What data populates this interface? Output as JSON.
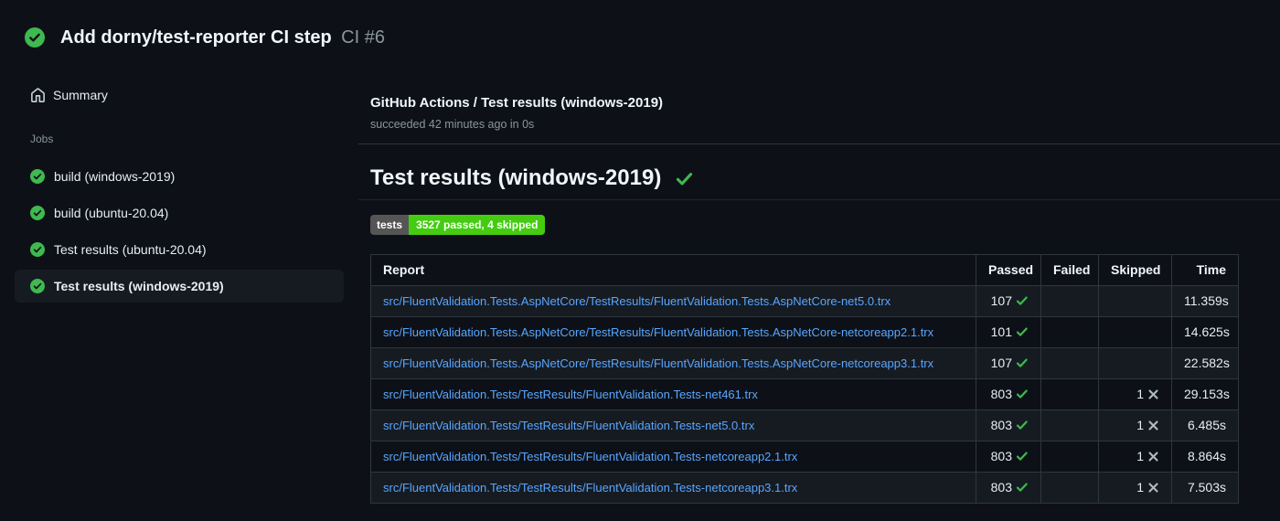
{
  "run_header": {
    "title": "Add dorny/test-reporter CI step",
    "run_number": "CI #6",
    "status": "success"
  },
  "sidebar": {
    "summary_label": "Summary",
    "jobs_label": "Jobs",
    "jobs": [
      {
        "label": "build (windows-2019)",
        "status": "success",
        "selected": false
      },
      {
        "label": "build (ubuntu-20.04)",
        "status": "success",
        "selected": false
      },
      {
        "label": "Test results (ubuntu-20.04)",
        "status": "success",
        "selected": false
      },
      {
        "label": "Test results (windows-2019)",
        "status": "success",
        "selected": true
      }
    ]
  },
  "check_header": {
    "title": "GitHub Actions / Test results (windows-2019)",
    "status_line": "succeeded 42 minutes ago in 0s"
  },
  "report": {
    "heading": "Test results (windows-2019)",
    "badge": {
      "label": "tests",
      "value": "3527 passed, 4 skipped"
    },
    "table": {
      "headers": [
        "Report",
        "Passed",
        "Failed",
        "Skipped",
        "Time"
      ],
      "rows": [
        {
          "report": "src/FluentValidation.Tests.AspNetCore/TestResults/FluentValidation.Tests.AspNetCore-net5.0.trx",
          "passed": "107",
          "failed": "",
          "skipped": "",
          "time": "11.359s"
        },
        {
          "report": "src/FluentValidation.Tests.AspNetCore/TestResults/FluentValidation.Tests.AspNetCore-netcoreapp2.1.trx",
          "passed": "101",
          "failed": "",
          "skipped": "",
          "time": "14.625s"
        },
        {
          "report": "src/FluentValidation.Tests.AspNetCore/TestResults/FluentValidation.Tests.AspNetCore-netcoreapp3.1.trx",
          "passed": "107",
          "failed": "",
          "skipped": "",
          "time": "22.582s"
        },
        {
          "report": "src/FluentValidation.Tests/TestResults/FluentValidation.Tests-net461.trx",
          "passed": "803",
          "failed": "",
          "skipped": "1",
          "time": "29.153s"
        },
        {
          "report": "src/FluentValidation.Tests/TestResults/FluentValidation.Tests-net5.0.trx",
          "passed": "803",
          "failed": "",
          "skipped": "1",
          "time": "6.485s"
        },
        {
          "report": "src/FluentValidation.Tests/TestResults/FluentValidation.Tests-netcoreapp2.1.trx",
          "passed": "803",
          "failed": "",
          "skipped": "1",
          "time": "8.864s"
        },
        {
          "report": "src/FluentValidation.Tests/TestResults/FluentValidation.Tests-netcoreapp3.1.trx",
          "passed": "803",
          "failed": "",
          "skipped": "1",
          "time": "7.503s"
        }
      ]
    }
  },
  "colors": {
    "background": "#0d1117",
    "row_alt": "#161b22",
    "border": "#30363d",
    "link_blue": "#58a6ff",
    "success_green": "#3fb950",
    "skipped_gray": "#b1bac4",
    "badge_label_bg": "#555555",
    "badge_value_bg": "#44cc11",
    "muted_text": "#8b949e"
  }
}
